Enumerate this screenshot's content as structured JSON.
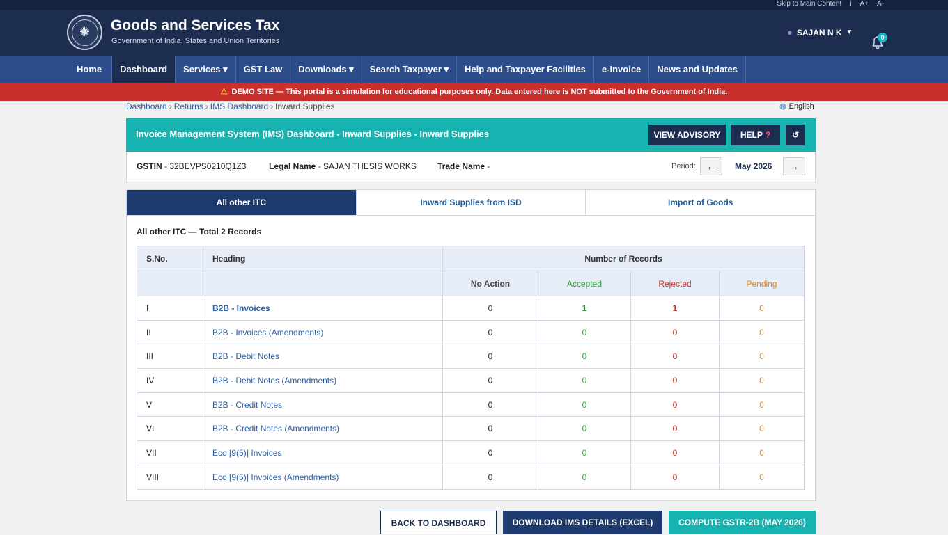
{
  "topbar": {
    "skip": "Skip to Main Content",
    "info": "i",
    "font_up": "A+",
    "font_down": "A-"
  },
  "brand": {
    "title": "Goods and Services Tax",
    "subtitle": "Government of India, States and Union Territories"
  },
  "user": {
    "name": "SAJAN N K",
    "caret": "▼",
    "notifications": "0"
  },
  "nav": [
    {
      "label": "Home"
    },
    {
      "label": "Dashboard"
    },
    {
      "label": "Services ▾"
    },
    {
      "label": "GST Law"
    },
    {
      "label": "Downloads ▾"
    },
    {
      "label": "Search Taxpayer ▾"
    },
    {
      "label": "Help and Taxpayer Facilities"
    },
    {
      "label": "e-Invoice"
    },
    {
      "label": "News and Updates"
    }
  ],
  "demo": {
    "icon": "⚠",
    "text": "DEMO SITE — This portal is a simulation for educational purposes only. Data entered here is NOT submitted to the Government of India."
  },
  "breadcrumb": {
    "c1": "Dashboard",
    "c2": "Returns",
    "c3": "IMS Dashboard",
    "c4": "Inward Supplies",
    "sep": "›"
  },
  "language": "English",
  "titlebar": {
    "title": "Invoice Management System (IMS) Dashboard - Inward Supplies - Inward Supplies",
    "advisory": "VIEW ADVISORY",
    "help": "HELP",
    "help_q": "?",
    "refresh": "↺"
  },
  "info": {
    "gstin_label": "GSTIN",
    "gstin": " - 32BEVPS0210Q1Z3",
    "legal_label": "Legal Name",
    "legal": " - SAJAN THESIS WORKS",
    "trade_label": "Trade Name",
    "trade": " -",
    "period_label": "Period:",
    "period": "May 2026",
    "prev": "←",
    "next": "→"
  },
  "tabs": {
    "t1": "All other ITC",
    "t2": "Inward Supplies from ISD",
    "t3": "Import of Goods"
  },
  "records_caption": "All other ITC — Total 2 Records",
  "table": {
    "h_sno": "S.No.",
    "h_heading": "Heading",
    "h_records": "Number of Records",
    "h_noaction": "No Action",
    "h_accepted": "Accepted",
    "h_rejected": "Rejected",
    "h_pending": "Pending",
    "rows": [
      {
        "sno": "I",
        "heading": "B2B - Invoices",
        "noaction": "0",
        "accepted": "1",
        "rejected": "1",
        "pending": "0"
      },
      {
        "sno": "II",
        "heading": "B2B - Invoices (Amendments)",
        "noaction": "0",
        "accepted": "0",
        "rejected": "0",
        "pending": "0"
      },
      {
        "sno": "III",
        "heading": "B2B - Debit Notes",
        "noaction": "0",
        "accepted": "0",
        "rejected": "0",
        "pending": "0"
      },
      {
        "sno": "IV",
        "heading": "B2B - Debit Notes (Amendments)",
        "noaction": "0",
        "accepted": "0",
        "rejected": "0",
        "pending": "0"
      },
      {
        "sno": "V",
        "heading": "B2B - Credit Notes",
        "noaction": "0",
        "accepted": "0",
        "rejected": "0",
        "pending": "0"
      },
      {
        "sno": "VI",
        "heading": "B2B - Credit Notes (Amendments)",
        "noaction": "0",
        "accepted": "0",
        "rejected": "0",
        "pending": "0"
      },
      {
        "sno": "VII",
        "heading": "Eco [9(5)] Invoices",
        "noaction": "0",
        "accepted": "0",
        "rejected": "0",
        "pending": "0"
      },
      {
        "sno": "VIII",
        "heading": "Eco [9(5)] Invoices (Amendments)",
        "noaction": "0",
        "accepted": "0",
        "rejected": "0",
        "pending": "0"
      }
    ]
  },
  "footer": {
    "back": "BACK TO DASHBOARD",
    "download": "DOWNLOAD IMS DETAILS (EXCEL)",
    "compute": "COMPUTE GSTR-2B (MAY 2026)"
  },
  "colors": {
    "header": "#1d2d50",
    "nav": "#2c4c8a",
    "demo": "#c8302c",
    "teal": "#17b3b0",
    "accepted": "#2e9e3b",
    "rejected": "#c8302c",
    "pending": "#e28a22"
  }
}
